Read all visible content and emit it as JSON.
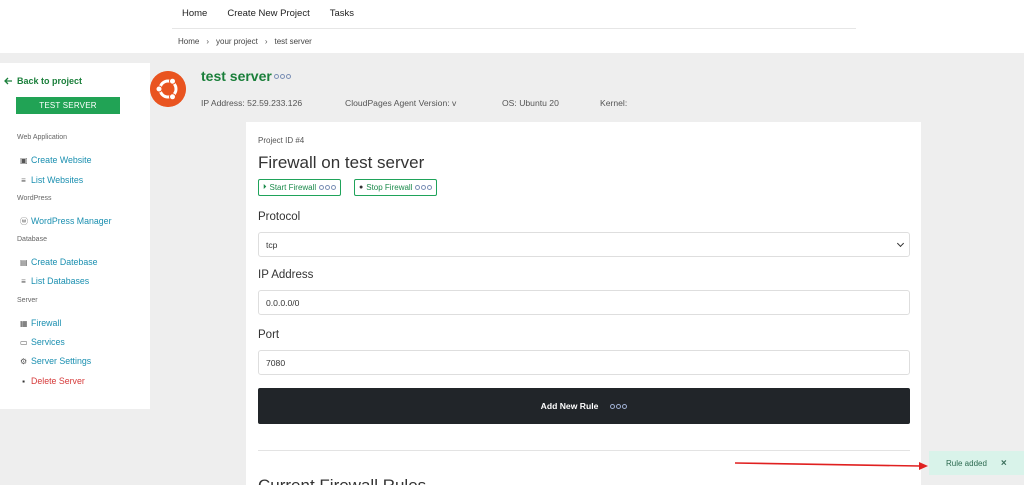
{
  "topnav": {
    "home": "Home",
    "create_project": "Create New Project",
    "tasks": "Tasks"
  },
  "breadcrumb": {
    "home": "Home",
    "project": "your project",
    "current": "test server",
    "separator": "›"
  },
  "sidebar": {
    "back": "Back to project",
    "server_button": "TEST SERVER",
    "sections": {
      "web_application": "Web Application",
      "wordpress": "WordPress",
      "database": "Database",
      "server": "Server"
    },
    "links": {
      "create_website": "Create Website",
      "list_websites": "List Websites",
      "wordpress_manager": "WordPress Manager",
      "create_database": "Create Datebase",
      "list_databases": "List Databases",
      "firewall": "Firewall",
      "services": "Services",
      "server_settings": "Server Settings",
      "delete_server": "Delete Server"
    }
  },
  "server": {
    "name": "test server",
    "ip": "IP Address: 52.59.233.126",
    "agent": "CloudPages Agent Version: v",
    "os": "OS: Ubuntu 20",
    "kernel": "Kernel:"
  },
  "firewall": {
    "project_id": "Project ID #4",
    "title": "Firewall on test server",
    "start_button": "Start Firewall",
    "stop_button": "Stop Firewall",
    "protocol_label": "Protocol",
    "protocol_value": "tcp",
    "ip_label": "IP Address",
    "ip_value": "0.0.0.0/0",
    "port_label": "Port",
    "port_value": "7080",
    "add_button": "Add New Rule",
    "current_rules_heading": "Current Firewall Rules"
  },
  "toast": {
    "message": "Rule added",
    "close": "×"
  },
  "colors": {
    "brand_green": "#21a355",
    "ubuntu_orange": "#e95420",
    "dark_button": "#212529",
    "link_blue": "#1a8fb0",
    "danger_red": "#d63a3a",
    "annotation_red": "#e02020"
  }
}
